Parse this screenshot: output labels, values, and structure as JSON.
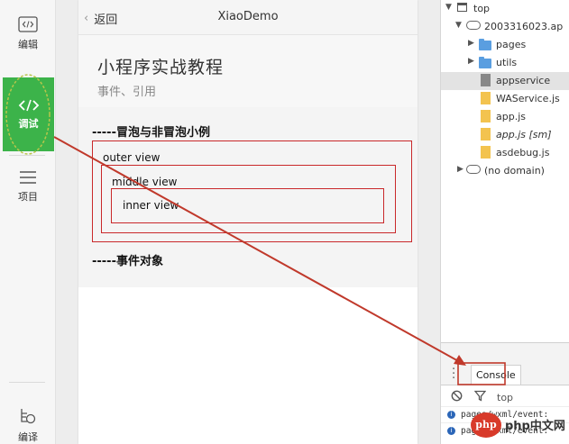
{
  "sidebar": {
    "items": [
      {
        "icon": "code-icon",
        "label": "编辑"
      },
      {
        "icon": "code-icon",
        "label": "调试"
      },
      {
        "icon": "menu-icon",
        "label": "项目"
      },
      {
        "icon": "compile-icon",
        "label": "编译"
      }
    ]
  },
  "simulator": {
    "nav": {
      "back_label": "返回",
      "title": "XiaoDemo"
    },
    "page": {
      "title": "小程序实战教程",
      "subtitle": "事件、引用",
      "section1": "-----冒泡与非冒泡小例",
      "outer_view": "outer view",
      "middle_view": "middle view",
      "inner_view": "inner view",
      "section2": "-----事件对象"
    }
  },
  "devtools": {
    "tree": [
      {
        "label": "top",
        "kind": "frame",
        "expanded": true
      },
      {
        "label": "2003316023.ap",
        "kind": "cloud",
        "expanded": true
      },
      {
        "label": "pages",
        "kind": "folder"
      },
      {
        "label": "utils",
        "kind": "folder"
      },
      {
        "label": "appservice",
        "kind": "file",
        "selected": true
      },
      {
        "label": "WAService.js",
        "kind": "js"
      },
      {
        "label": "app.js",
        "kind": "js"
      },
      {
        "label": "app.js [sm]",
        "kind": "js"
      },
      {
        "label": "asdebug.js",
        "kind": "js"
      },
      {
        "label": "(no domain)",
        "kind": "cloud",
        "expanded": false
      }
    ],
    "console": {
      "tab_label": "Console",
      "context": "top",
      "logs": [
        "pages/wxml/event:",
        "pages/wxml/event:"
      ]
    }
  },
  "watermark": {
    "text": "php中文网",
    "logo": "php"
  },
  "colors": {
    "accent_green": "#3cb34a",
    "box_red": "#c9282a",
    "arrow_red": "#c0392b",
    "folder_blue": "#5a9ee0",
    "js_yellow": "#f3c34f"
  }
}
